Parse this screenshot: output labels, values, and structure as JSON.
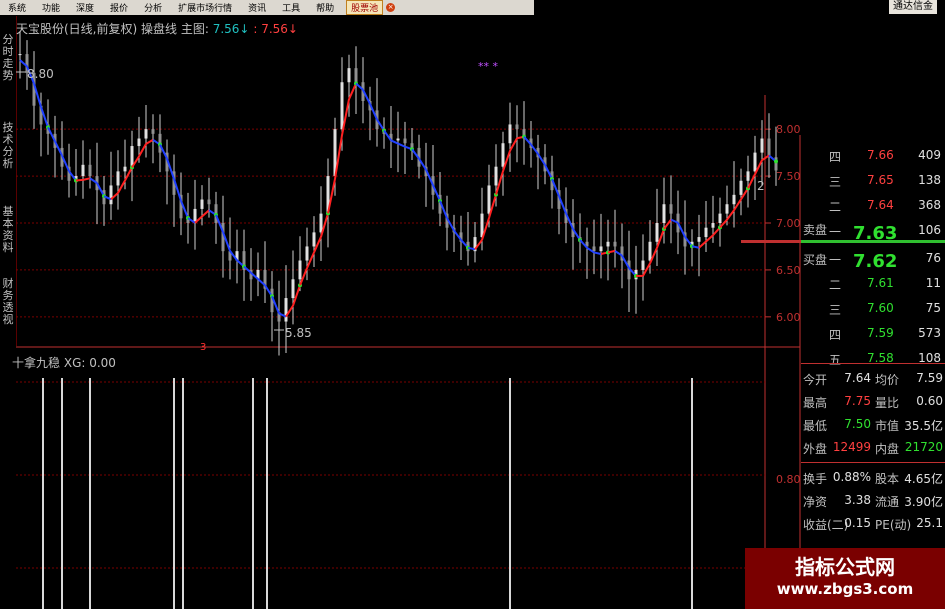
{
  "menubar": {
    "items": [
      "系统",
      "功能",
      "深度",
      "报价",
      "分析",
      "扩展市场行情",
      "资讯",
      "工具",
      "帮助"
    ],
    "highlight": "股票池",
    "brand": "通达信金"
  },
  "sidetabs": [
    "分时走势",
    "技术分析",
    "基本资料",
    "财务透视"
  ],
  "chart_header": {
    "name": "天宝股份(日线,前复权)",
    "indicator": "操盘线 主图:",
    "val1": "7.56",
    "arrow1": "↓",
    "sep": ":",
    "val2": "7.56",
    "arrow2": "↓"
  },
  "sub_indicator": {
    "name": "十拿九稳",
    "label": "XG: 0.00"
  },
  "price_axis": {
    "ticks": [
      "8.00",
      "7.50",
      "7.00",
      "6.50",
      "6.00"
    ],
    "sub_tick": "0.80"
  },
  "annotations": {
    "high": "8.80",
    "low": "5.85",
    "right_marker": "2",
    "bottom_marker": "3",
    "purple": "** *"
  },
  "quote": {
    "sell": [
      {
        "label": "四",
        "price": "7.66",
        "vol": "409"
      },
      {
        "label": "三",
        "price": "7.65",
        "vol": "138"
      },
      {
        "label": "二",
        "price": "7.64",
        "vol": "368"
      },
      {
        "label": "一",
        "price": "7.63",
        "vol": "106"
      }
    ],
    "sell_label": "卖盘",
    "buy_label": "买盘",
    "buy": [
      {
        "label": "一",
        "price": "7.62",
        "vol": "76"
      },
      {
        "label": "二",
        "price": "7.61",
        "vol": "11"
      },
      {
        "label": "三",
        "price": "7.60",
        "vol": "75"
      },
      {
        "label": "四",
        "price": "7.59",
        "vol": "573"
      },
      {
        "label": "五",
        "price": "7.58",
        "vol": "108"
      }
    ],
    "stats": [
      {
        "k1": "今开",
        "v1": "7.64",
        "k2": "均价",
        "v2": "7.59"
      },
      {
        "k1": "最高",
        "v1": "7.75",
        "k2": "量比",
        "v2": "0.60"
      },
      {
        "k1": "最低",
        "v1": "7.50",
        "k2": "市值",
        "v2": "35.5亿"
      },
      {
        "k1": "外盘",
        "v1": "12499",
        "k2": "内盘",
        "v2": "21720"
      }
    ],
    "stats2": [
      {
        "k1": "换手",
        "v1": "0.88%",
        "k2": "股本",
        "v2": "4.65亿"
      },
      {
        "k1": "净资",
        "v1": "3.38",
        "k2": "流通",
        "v2": "3.90亿"
      },
      {
        "k1": "收益(二)",
        "v1": "0.15",
        "k2": "PE(动)",
        "v2": "25.1"
      }
    ]
  },
  "watermark": {
    "title": "指标公式网",
    "url": "www.zbgs3.com"
  },
  "colors": {
    "up": "#ff4040",
    "down": "#20d0d0",
    "green": "#30e030",
    "grid": "#7a0000",
    "axis": "#c03030",
    "blue_line": "#2040ff",
    "red_line": "#ff2020"
  },
  "chart_data": {
    "type": "candlestick",
    "ylim": [
      5.7,
      8.95
    ],
    "closes": [
      8.8,
      8.6,
      8.25,
      8.05,
      7.95,
      7.8,
      7.6,
      7.45,
      7.5,
      7.62,
      7.5,
      7.35,
      7.2,
      7.4,
      7.55,
      7.6,
      7.82,
      7.9,
      8.0,
      7.95,
      7.75,
      7.55,
      7.3,
      7.05,
      7.0,
      7.15,
      7.25,
      7.2,
      7.0,
      6.7,
      6.6,
      6.7,
      6.5,
      6.4,
      6.5,
      6.3,
      6.05,
      5.95,
      6.2,
      6.4,
      6.6,
      6.75,
      6.9,
      7.1,
      7.5,
      8.0,
      8.5,
      8.65,
      8.5,
      8.3,
      8.2,
      8.0,
      7.95,
      7.88,
      7.9,
      7.85,
      7.8,
      7.6,
      7.5,
      7.3,
      7.1,
      6.95,
      6.9,
      6.8,
      6.7,
      6.85,
      7.1,
      7.4,
      7.6,
      7.85,
      8.05,
      8.0,
      7.9,
      7.8,
      7.7,
      7.55,
      7.35,
      7.15,
      7.0,
      6.85,
      6.8,
      6.75,
      6.7,
      6.75,
      6.8,
      6.75,
      6.6,
      6.4,
      6.5,
      6.6,
      6.8,
      7.0,
      7.2,
      7.1,
      6.9,
      6.75,
      6.8,
      6.85,
      6.95,
      7.0,
      7.1,
      7.2,
      7.3,
      7.45,
      7.55,
      7.75,
      7.9,
      7.7,
      7.56
    ],
    "sub_signals": [
      3,
      6,
      10,
      22,
      23,
      33,
      35,
      70,
      96
    ]
  }
}
